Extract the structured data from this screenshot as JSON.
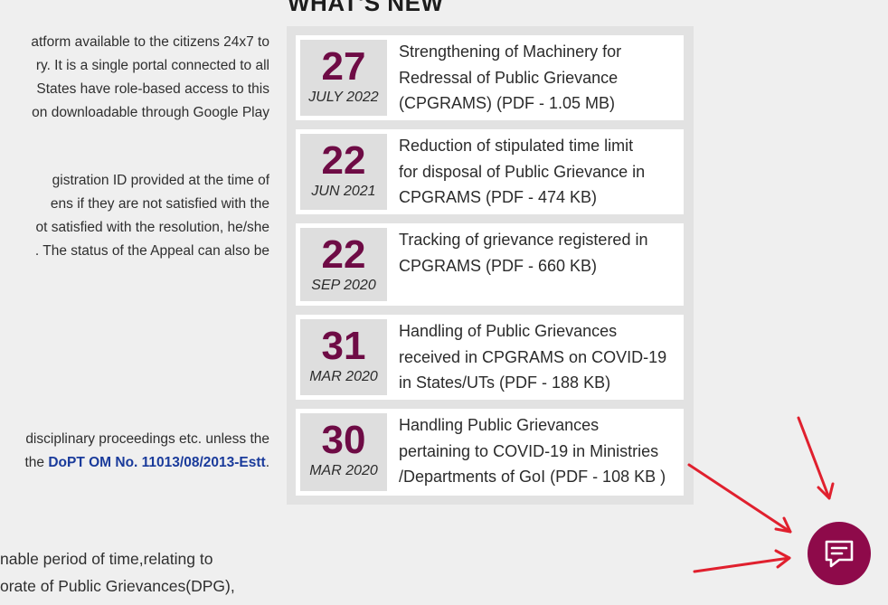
{
  "left_column": {
    "paragraph_1": [
      "atform available to the citizens 24x7 to",
      "ry. It is a single portal connected to all",
      "States have role-based access to this",
      "on downloadable through Google Play"
    ],
    "paragraph_2": [
      "gistration ID provided at the time of",
      "ens if they are not satisfied with the",
      "ot satisfied with the resolution, he/she",
      ". The status of the Appeal can also be"
    ],
    "paragraph_3_line_1": "disciplinary proceedings etc. unless the",
    "paragraph_3_line_2_prefix": "the ",
    "paragraph_3_link": "DoPT OM No. 11013/08/2013-Estt",
    "paragraph_3_line_2_suffix": ".",
    "paragraph_4": [
      "nable period of time,relating to",
      "orate of Public Grievances(DPG),"
    ]
  },
  "whats_new": {
    "heading": "WHAT'S NEW",
    "items": [
      {
        "day": "27",
        "month": "JULY 2022",
        "lines": [
          "Strengthening of Machinery for",
          "Redressal of Public Grievance",
          "(CPGRAMS) (PDF - 1.05 MB)"
        ]
      },
      {
        "day": "22",
        "month": "JUN 2021",
        "lines": [
          "Reduction of stipulated time limit",
          "for disposal of Public Grievance in",
          "CPGRAMS (PDF - 474 KB)"
        ]
      },
      {
        "day": "22",
        "month": "SEP 2020",
        "lines": [
          "Tracking of grievance registered in",
          "CPGRAMS (PDF - 660 KB)"
        ]
      },
      {
        "day": "31",
        "month": "MAR 2020",
        "lines": [
          "Handling of Public Grievances",
          "received in CPGRAMS on COVID-19",
          "in States/UTs (PDF - 188 KB)"
        ]
      },
      {
        "day": "30",
        "month": "MAR 2020",
        "lines": [
          "Handling Public Grievances",
          "pertaining to COVID-19 in Ministries",
          "/Departments of GoI (PDF - 108 KB )"
        ]
      }
    ]
  },
  "chat": {
    "icon": "chat-bubble-icon"
  },
  "colors": {
    "accent": "#6e0b45",
    "chat_button": "#8e0a4a",
    "arrow": "#e0202e",
    "link": "#1a3b9b"
  }
}
